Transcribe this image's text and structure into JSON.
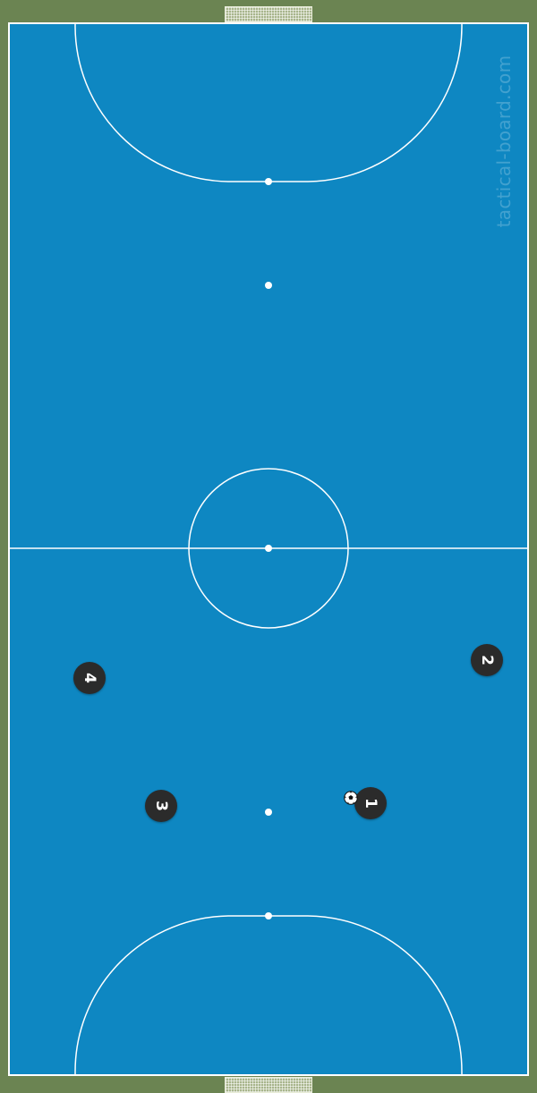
{
  "watermark": "tactical-board.com",
  "colors": {
    "court": "#0e87c2",
    "surround": "#6b8452",
    "lines": "#ffffff",
    "player": "#2b2b2b"
  },
  "players": [
    {
      "number": "1"
    },
    {
      "number": "2"
    },
    {
      "number": "3"
    },
    {
      "number": "4"
    }
  ],
  "ball": {
    "icon": "soccer-ball-icon"
  }
}
